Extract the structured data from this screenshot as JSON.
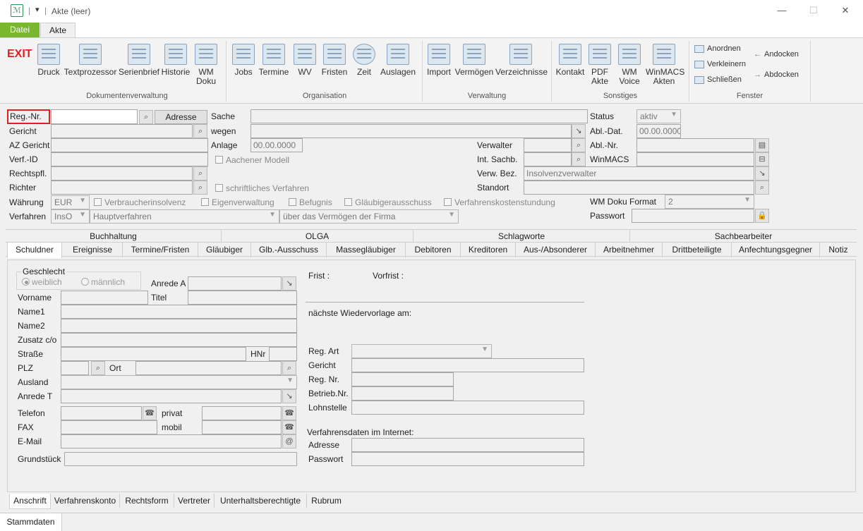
{
  "window": {
    "title": "Akte (leer)",
    "min": "—",
    "max": "☐",
    "close": "✕"
  },
  "ribbon_tabs": {
    "file": "Datei",
    "akte": "Akte"
  },
  "ribbon": {
    "exit": "EXIT",
    "doc_buttons": [
      "Druck",
      "Textprozessor",
      "Serienbrief",
      "Historie",
      "WM Doku"
    ],
    "doc_group": "Dokumentenverwaltung",
    "org_buttons": [
      "Jobs",
      "Termine",
      "WV",
      "Fristen",
      "Zeit",
      "Auslagen"
    ],
    "org_group": "Organisation",
    "verw_buttons": [
      "Import",
      "Vermögen",
      "Verzeichnisse"
    ],
    "verw_group": "Verwaltung",
    "sonst_buttons": [
      "Kontakt",
      "PDF Akte",
      "WM Voice",
      "WinMACS Akten"
    ],
    "sonst_group": "Sonstiges",
    "fenster_buttons": [
      "Anordnen",
      "Verkleinern",
      "Schließen",
      "Andocken",
      "Abdocken"
    ],
    "fenster_group": "Fenster"
  },
  "header_form": {
    "reg_nr_label": "Reg.-Nr.",
    "adresse_button": "Adresse",
    "gericht": "Gericht",
    "az_gericht": "AZ Gericht",
    "verf_id": "Verf.-ID",
    "rechtspfl": "Rechtspfl.",
    "richter": "Richter",
    "waehrung": "Währung",
    "waehrung_value": "EUR",
    "verfahren": "Verfahren",
    "verfahren_value": "InsO",
    "verfahrensart_value": "Hauptverfahren",
    "verfahren_detail_value": "über das Vermögen der Firma",
    "sache": "Sache",
    "wegen": "wegen",
    "anlage": "Anlage",
    "anlage_value": "00.00.0000",
    "aachener": "Aachener Modell",
    "schriftlich": "schriftliches Verfahren",
    "verbraucher": "Verbraucherinsolvenz",
    "eigenverwaltung": "Eigenverwaltung",
    "befugnis": "Befugnis",
    "glaeubigerausschuss": "Gläubigerausschuss",
    "verfahrenskosten": "Verfahrenskostenstundung",
    "verwalter": "Verwalter",
    "int_sachb": "Int. Sachb.",
    "verw_bez": "Verw. Bez.",
    "verw_bez_value": "Insolvenzverwalter",
    "standort": "Standort",
    "status": "Status",
    "status_value": "aktiv",
    "abl_dat": "Abl.-Dat.",
    "abl_dat_value": "00.00.0000",
    "abl_nr": "Abl.-Nr.",
    "winmacs": "WinMACS",
    "wm_doku_format": "WM Doku Format",
    "wm_doku_format_value": "2",
    "passwort": "Passwort"
  },
  "tabs_row1": [
    "Buchhaltung",
    "OLGA",
    "Schlagworte",
    "Sachbearbeiter"
  ],
  "tabs_row2": [
    "Schuldner",
    "Ereignisse",
    "Termine/Fristen",
    "Gläubiger",
    "Glb.-Ausschuss",
    "Massegläubiger",
    "Debitoren",
    "Kreditoren",
    "Aus-/Absonderer",
    "Arbeitnehmer",
    "Drittbeteiligte",
    "Anfechtungsgegner",
    "Notiz"
  ],
  "schuldner": {
    "geschlecht": "Geschlecht",
    "weiblich": "weiblich",
    "maennlich": "männlich",
    "anrede_a": "Anrede A",
    "vorname": "Vorname",
    "titel": "Titel",
    "name1": "Name1",
    "name2": "Name2",
    "zusatz": "Zusatz c/o",
    "strasse": "Straße",
    "hnr": "HNr",
    "plz": "PLZ",
    "ort": "Ort",
    "ausland": "Ausland",
    "anrede_t": "Anrede T",
    "telefon": "Telefon",
    "privat": "privat",
    "fax": "FAX",
    "mobil": "mobil",
    "email": "E-Mail",
    "grundstueck": "Grundstück",
    "frist": "Frist :",
    "vorfrist": "Vorfrist :",
    "wiedervorlage": "nächste Wiedervorlage am:",
    "reg_art": "Reg. Art",
    "gericht": "Gericht",
    "reg_nr": "Reg. Nr.",
    "betrieb_nr": "Betrieb.Nr.",
    "lohnstelle": "Lohnstelle",
    "internet": "Verfahrensdaten im Internet:",
    "adresse": "Adresse",
    "passwort": "Passwort"
  },
  "bottom_tabs": [
    "Anschrift",
    "Verfahrenskonto",
    "Rechtsform",
    "Vertreter",
    "Unterhaltsberechtigte",
    "Rubrum"
  ],
  "status_tab": "Stammdaten"
}
